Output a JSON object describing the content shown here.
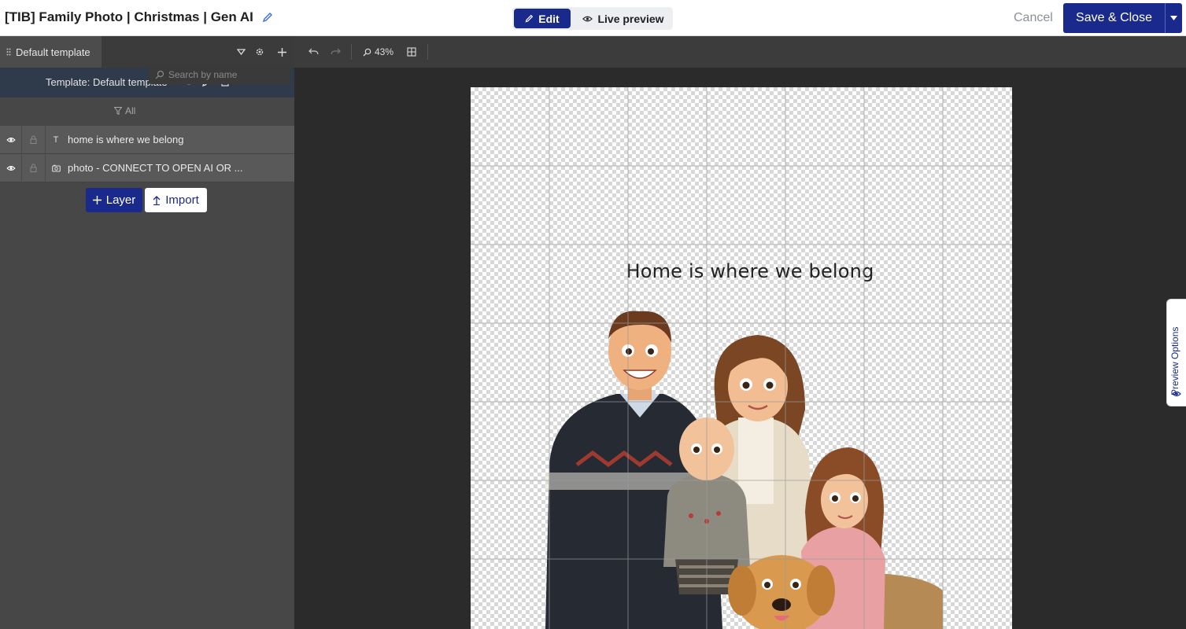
{
  "header": {
    "title": "[TIB] Family Photo | Christmas | Gen AI",
    "mode_edit": "Edit",
    "mode_live": "Live preview",
    "cancel": "Cancel",
    "save_close": "Save & Close"
  },
  "left_panel": {
    "active_tab": "Default template",
    "template_label": "Template: Default template",
    "filter_label": "All",
    "search_placeholder": "Search by name",
    "layers": [
      {
        "type_icon": "T",
        "name": "home is where we belong"
      },
      {
        "type_icon": "photo",
        "name": "photo - CONNECT TO OPEN AI OR ..."
      }
    ],
    "add_layer": "Layer",
    "import": "Import"
  },
  "toolbar": {
    "zoom": "43%"
  },
  "canvas": {
    "text_layer": "Home is where we belong"
  },
  "preview_options": "Preview Options",
  "colors": {
    "accent": "#1a2a8c",
    "panel": "#474747",
    "workspace": "#2b2b2b"
  }
}
